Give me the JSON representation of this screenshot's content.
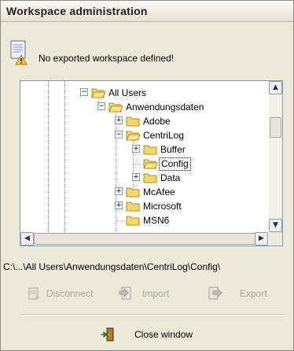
{
  "dialog": {
    "title": "Workspace administration"
  },
  "message": {
    "text": "No exported workspace defined!",
    "icon": "document-warning-icon"
  },
  "tree": {
    "nodes": [
      {
        "label": "All Users",
        "expander": "−",
        "selected": false
      },
      {
        "label": "Anwendungsdaten",
        "expander": "−",
        "selected": false
      },
      {
        "label": "Adobe",
        "expander": "+",
        "selected": false
      },
      {
        "label": "CentriLog",
        "expander": "−",
        "selected": false
      },
      {
        "label": "Buffer",
        "expander": "+",
        "selected": false
      },
      {
        "label": "Config",
        "expander": "",
        "selected": true
      },
      {
        "label": "Data",
        "expander": "+",
        "selected": false
      },
      {
        "label": "McAfee",
        "expander": "+",
        "selected": false
      },
      {
        "label": "Microsoft",
        "expander": "+",
        "selected": false
      },
      {
        "label": "MSN6",
        "expander": "",
        "selected": false
      }
    ],
    "scroll_up": "▲",
    "scroll_down": "▼",
    "scroll_left": "◀",
    "scroll_right": "▶",
    "folder_color": "#f5d66a"
  },
  "path": {
    "text": "C:\\...\\All Users\\Anwendungsdaten\\CentriLog\\Config\\"
  },
  "actions": {
    "disconnect": "Disconnect",
    "import": "Import",
    "export": "Export",
    "disabled_color": "#a8a59a"
  },
  "close_button": {
    "label": "Close window"
  }
}
